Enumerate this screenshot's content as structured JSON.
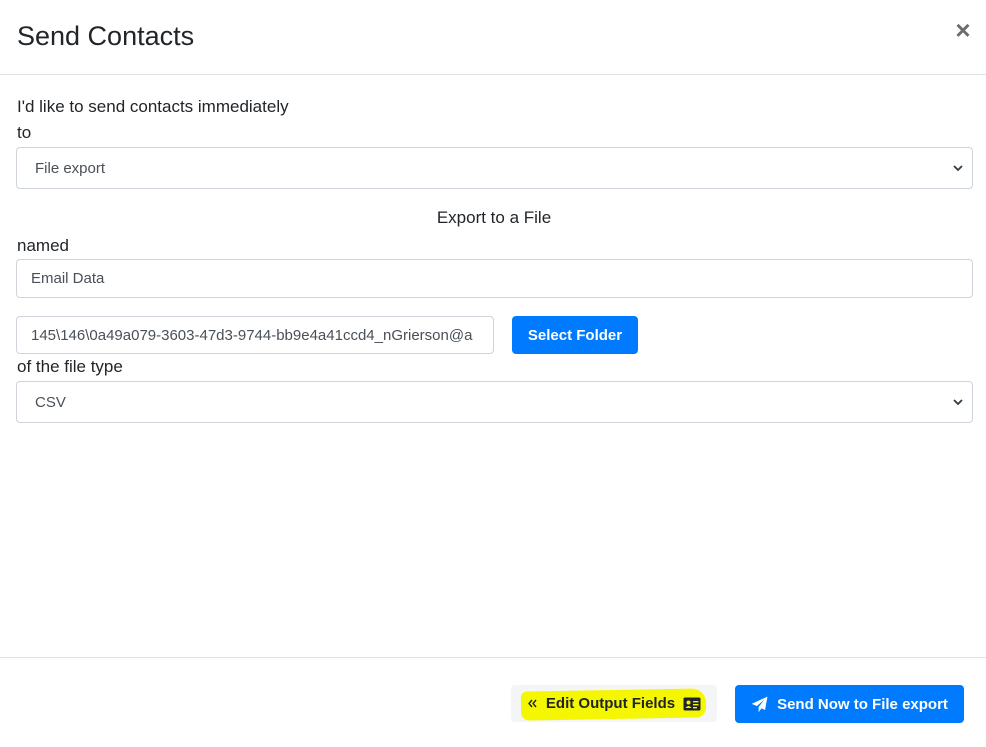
{
  "modal": {
    "title": "Send Contacts",
    "close_symbol": "×"
  },
  "form": {
    "intro_label": "I'd like to send contacts immediately",
    "to_label": "to",
    "destination": {
      "selected": "File export"
    },
    "section_heading": "Export to a File",
    "named_label": "named",
    "file_name": {
      "value": "Email Data"
    },
    "folder_path": {
      "value": "145\\146\\0a49a079-3603-47d3-9744-bb9e4a41ccd4_nGrierson@a"
    },
    "select_folder_label": "Select Folder",
    "file_type_label": "of the file type",
    "file_type": {
      "selected": "CSV"
    }
  },
  "footer": {
    "edit_output_fields_label": "Edit Output Fields",
    "send_now_label": "Send Now to File export"
  },
  "icons": {
    "close": "close-icon",
    "chevron": "chevron-down-icon",
    "double_left": "double-chevron-left-icon",
    "id_card": "id-card-icon",
    "send": "paper-plane-icon"
  },
  "colors": {
    "primary": "#007bff",
    "highlight": "#f4f700"
  }
}
